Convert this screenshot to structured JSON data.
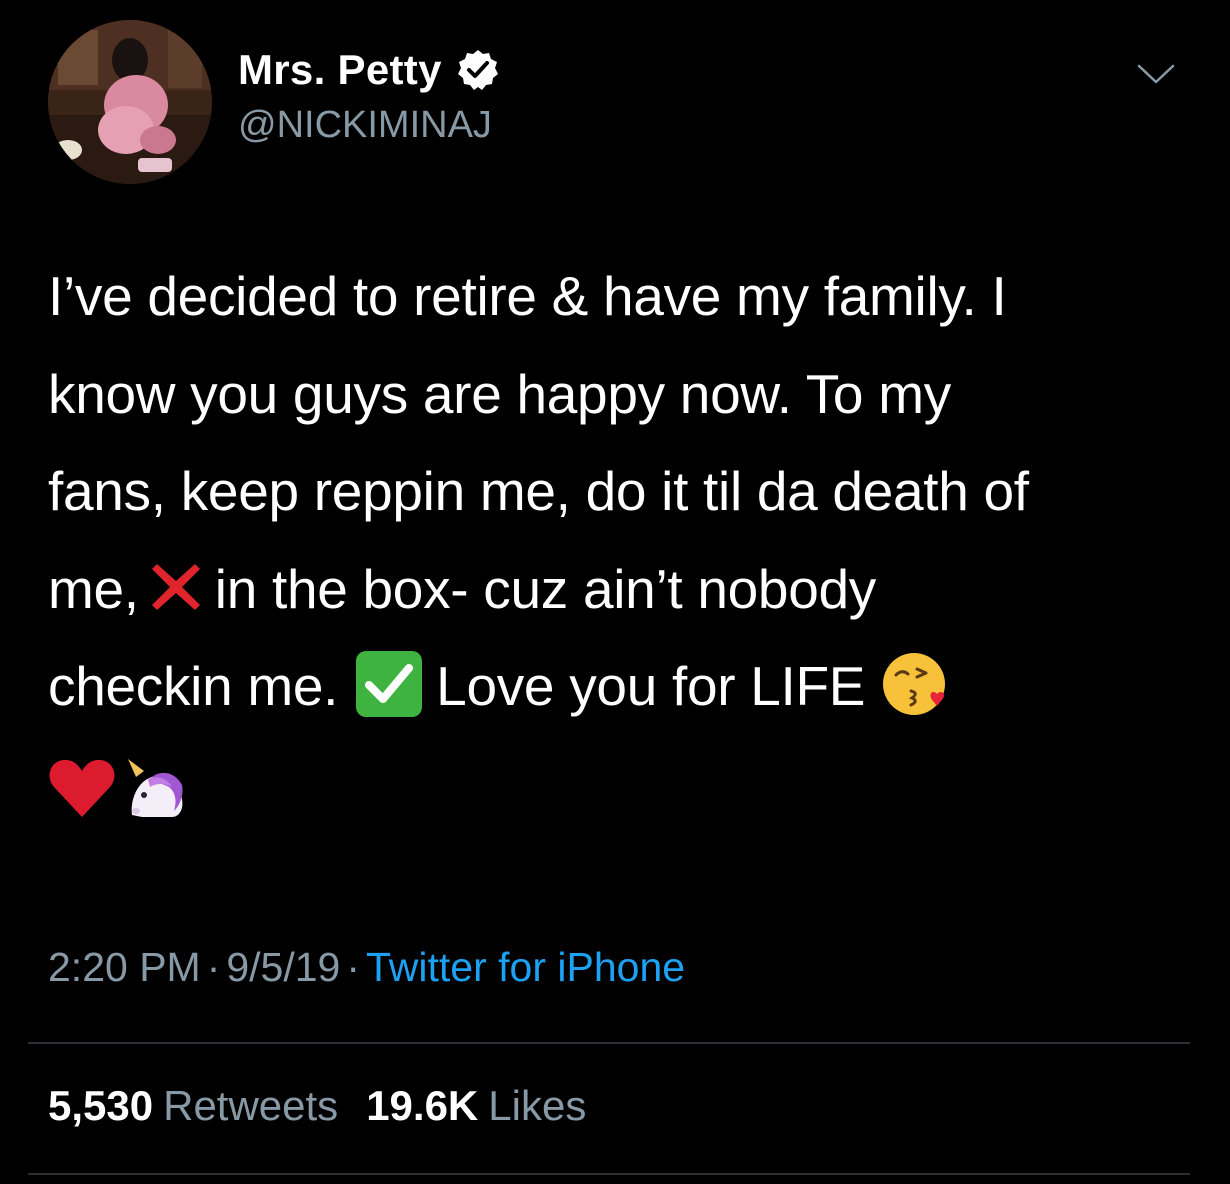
{
  "user": {
    "display_name": "Mrs. Petty",
    "handle": "@NICKIMINAJ",
    "verified": true
  },
  "tweet": {
    "lines": [
      [
        "I’ve decided to retire & have my family. I"
      ],
      [
        "know you guys are happy now. To my"
      ],
      [
        "fans, keep reppin me, do it til da death of"
      ],
      [
        "me, ",
        "cross-mark-emoji",
        " in the box- cuz ain’t nobody"
      ],
      [
        "checkin me. ",
        "check-mark-button-emoji",
        " Love you for LIFE ",
        "kissing-face-emoji"
      ],
      [
        "red-heart-emoji",
        "unicorn-emoji"
      ]
    ],
    "line_1": "I’ve decided to retire & have my family. I",
    "line_2": "know you guys are happy now. To my",
    "line_3": "fans, keep reppin me, do it til da death of",
    "line_4_a": "me,",
    "line_4_b": "in the box- cuz ain’t nobody",
    "line_5_a": "checkin me.",
    "line_5_b": "Love you for LIFE"
  },
  "meta": {
    "time": "2:20 PM",
    "date": "9/5/19",
    "separator": "·",
    "source": "Twitter for iPhone"
  },
  "stats": {
    "retweets_count": "5,530",
    "retweets_label": "Retweets",
    "likes_count": "19.6K",
    "likes_label": "Likes"
  },
  "colors": {
    "background": "#000000",
    "text_primary": "#ffffff",
    "text_secondary": "#8899a6",
    "link": "#1da1f2",
    "divider": "#2a2f33"
  },
  "icons": {
    "verified": "verified-badge-icon",
    "menu": "chevron-down-icon"
  }
}
